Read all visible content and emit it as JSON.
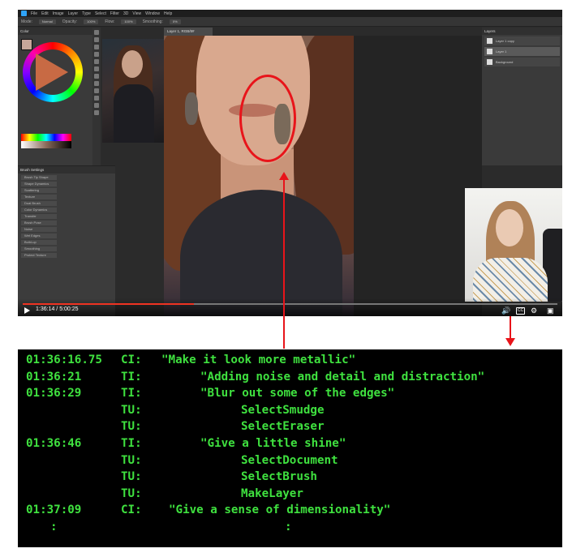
{
  "video": {
    "menu_items": [
      "File",
      "Edit",
      "Image",
      "Layer",
      "Type",
      "Select",
      "Filter",
      "3D",
      "View",
      "Window",
      "Help"
    ],
    "options": {
      "mode_label": "Mode:",
      "mode_value": "Normal",
      "opacity_label": "Opacity:",
      "opacity_value": "100%",
      "flow_label": "Flow:",
      "flow_value": "100%",
      "smoothing_label": "Smoothing:",
      "smoothing_value": "0%"
    },
    "left_panel_title": "Color",
    "brush_panel_title": "Brush Settings",
    "brush_items": [
      "Brush Tip Shape",
      "Shape Dynamics",
      "Scattering",
      "Texture",
      "Dual Brush",
      "Color Dynamics",
      "Transfer",
      "Brush Pose",
      "Noise",
      "Wet Edges",
      "Build-up",
      "Smoothing",
      "Protect Texture"
    ],
    "canvas_tab": "Layer 1, RGB/8#",
    "layers_title": "Layers",
    "layers": [
      "Layer 1 copy",
      "Layer 1",
      "Background"
    ],
    "current_time": "1:36:14",
    "duration": "5:00:25",
    "time_display": "1:36:14 / 5:00:25",
    "progress_fraction": 0.32,
    "controls": {
      "volume_icon": "volume-icon",
      "cc_label": "CC",
      "settings_icon": "gear-icon",
      "fullscreen_icon": "fullscreen-icon"
    }
  },
  "transcript": [
    {
      "time": "01:36:16.75",
      "speaker": "CI:",
      "text": "\"Make it look more metallic\"",
      "indent": 1
    },
    {
      "time": "01:36:21",
      "speaker": "TI:",
      "text": "\"Adding noise and detail and distraction\"",
      "indent": 2
    },
    {
      "time": "01:36:29",
      "speaker": "TI:",
      "text": "\"Blur out some of the edges\"",
      "indent": 2
    },
    {
      "time": "",
      "speaker": "TU:",
      "text": "SelectSmudge",
      "indent": 3
    },
    {
      "time": "",
      "speaker": "TU:",
      "text": "SelectEraser",
      "indent": 3
    },
    {
      "time": "01:36:46",
      "speaker": "TI:",
      "text": "\"Give a little shine\"",
      "indent": 2
    },
    {
      "time": "",
      "speaker": "TU:",
      "text": "SelectDocument",
      "indent": 3
    },
    {
      "time": "",
      "speaker": "TU:",
      "text": "SelectBrush",
      "indent": 3
    },
    {
      "time": "",
      "speaker": "TU:",
      "text": "MakeLayer",
      "indent": 3
    },
    {
      "time": "01:37:09",
      "speaker": "CI:",
      "text": "\"Give a sense of dimensionality\"",
      "indent": 1
    },
    {
      "time": ":",
      "speaker": "",
      "text": ":",
      "indent": 4
    }
  ],
  "colors": {
    "annotation_red": "#e8141a",
    "terminal_green": "#3fe13f",
    "terminal_bg": "#000000"
  }
}
